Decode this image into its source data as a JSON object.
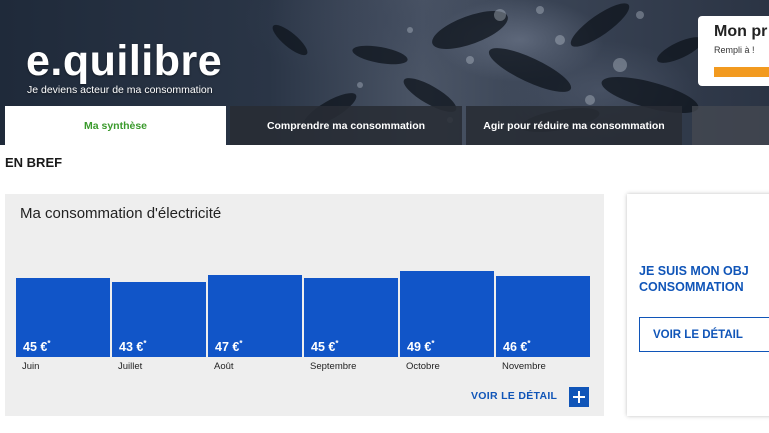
{
  "header": {
    "logo": "e.quilibre",
    "tagline": "Je deviens acteur de ma consommation",
    "profile_title": "Mon pr",
    "profile_subtitle": "Rempli à !",
    "profile_progress_color": "#f29a1f"
  },
  "tabs": [
    {
      "label": "Ma synthèse",
      "active": true
    },
    {
      "label": "Comprendre ma consommation",
      "active": false
    },
    {
      "label": "Agir pour réduire ma consommation",
      "active": false
    },
    {
      "label": "",
      "active": false
    }
  ],
  "section_title": "EN BREF",
  "consumption": {
    "title": "Ma consommation d'électricité",
    "currency_suffix": "€",
    "footnote_mark": "*",
    "link_label": "VOIR LE DÉTAIL",
    "bar_color": "#1155c8",
    "months": [
      {
        "month": "Juin",
        "value": 45,
        "label": "45 €"
      },
      {
        "month": "Juillet",
        "value": 43,
        "label": "43 €"
      },
      {
        "month": "Août",
        "value": 47,
        "label": "47 €"
      },
      {
        "month": "Septembre",
        "value": 45,
        "label": "45 €"
      },
      {
        "month": "Octobre",
        "value": 49,
        "label": "49 €"
      },
      {
        "month": "Novembre",
        "value": 46,
        "label": "46 €"
      }
    ]
  },
  "objective_card": {
    "heading_line1": "JE SUIS MON OBJ",
    "heading_line2": "CONSOMMATION",
    "button_label": "VOIR LE DÉTAIL"
  },
  "colors": {
    "accent_blue": "#1055b8",
    "active_tab_green": "#3a9a2c"
  }
}
